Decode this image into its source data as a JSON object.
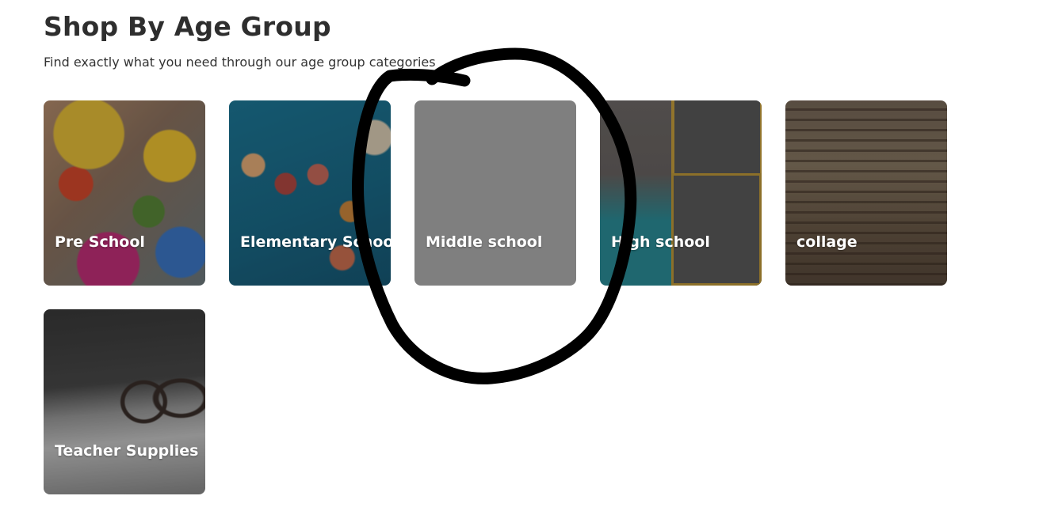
{
  "header": {
    "title": "Shop By Age Group",
    "subtitle": "Find exactly what you need through our age group categories"
  },
  "categories": [
    {
      "label": "Pre School"
    },
    {
      "label": "Elementary School"
    },
    {
      "label": "Middle school"
    },
    {
      "label": "High school"
    },
    {
      "label": "collage"
    },
    {
      "label": "Teacher Supplies"
    }
  ],
  "annotation": {
    "color": "#000000"
  }
}
